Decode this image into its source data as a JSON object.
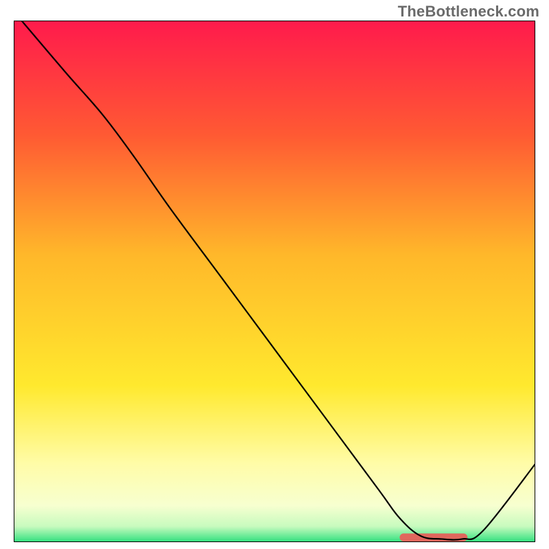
{
  "watermark": "TheBottleneck.com",
  "chart_data": {
    "type": "line",
    "title": "",
    "xlabel": "",
    "ylabel": "",
    "xlim": [
      0,
      100
    ],
    "ylim": [
      0,
      100
    ],
    "grid": false,
    "legend": false,
    "background_gradient": {
      "direction": "vertical",
      "stops": [
        {
          "pos": 0.0,
          "color": "#ff1a4c"
        },
        {
          "pos": 0.22,
          "color": "#ff5a33"
        },
        {
          "pos": 0.45,
          "color": "#ffb82a"
        },
        {
          "pos": 0.7,
          "color": "#ffe92e"
        },
        {
          "pos": 0.85,
          "color": "#fffca8"
        },
        {
          "pos": 0.93,
          "color": "#f7ffd0"
        },
        {
          "pos": 0.97,
          "color": "#c7fbbe"
        },
        {
          "pos": 1.0,
          "color": "#2fe07e"
        }
      ]
    },
    "series": [
      {
        "name": "curve",
        "color": "#000000",
        "stroke_width": 2.2,
        "x": [
          1.5,
          10,
          17,
          23,
          30,
          40,
          50,
          60,
          70,
          74,
          78,
          82,
          86,
          90,
          100
        ],
        "y": [
          100,
          90,
          82,
          74,
          64,
          50.5,
          37,
          23.5,
          10,
          4.6,
          1.2,
          0.6,
          0.6,
          2.2,
          15
        ]
      }
    ],
    "annotations": [
      {
        "name": "bottom-marker",
        "shape": "rounded-bar",
        "color": "#e0675d",
        "x_start": 74,
        "x_end": 87,
        "y": 0.9,
        "height_pct": 1.0
      }
    ]
  }
}
